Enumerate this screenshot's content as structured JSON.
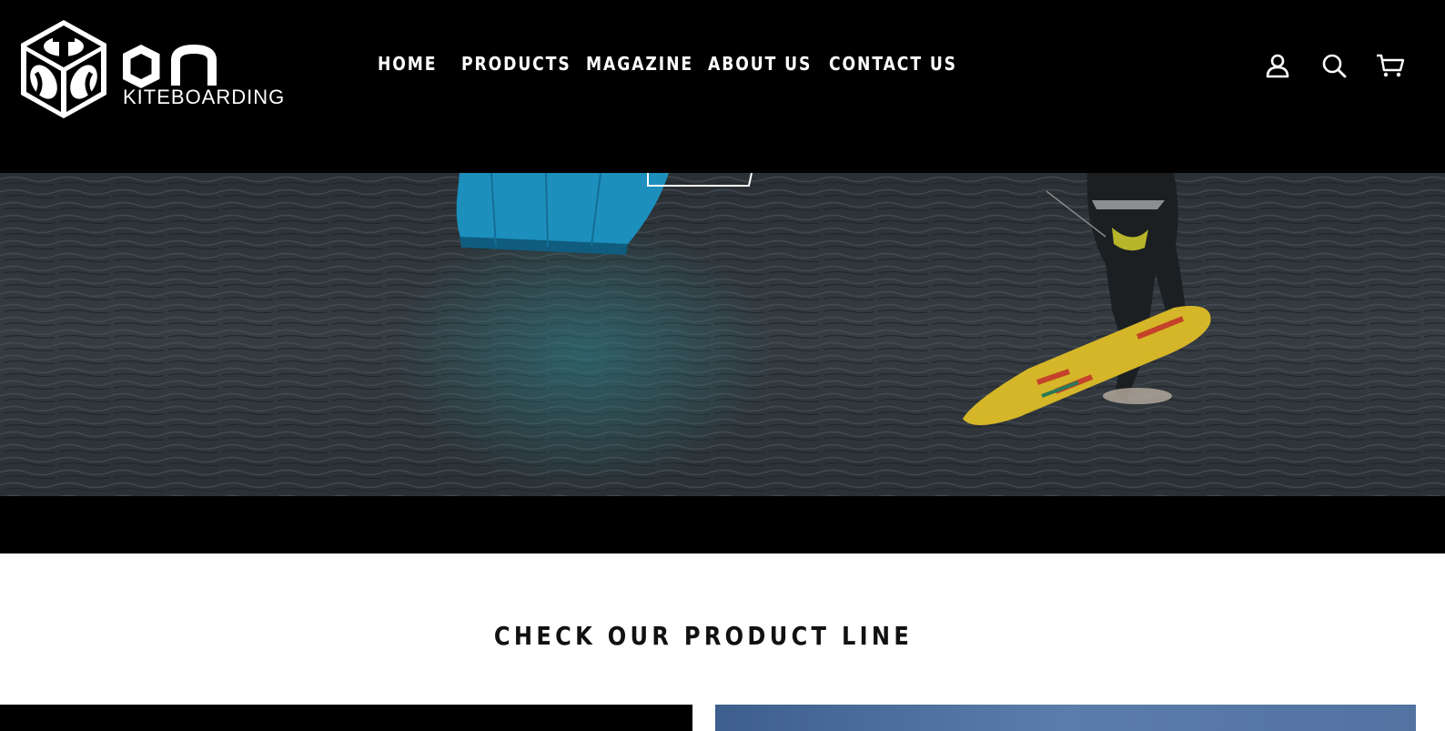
{
  "brand": {
    "logo_text": "on",
    "logo_subtext": "KITEBOARDING"
  },
  "nav": {
    "items": [
      {
        "label": "HOME"
      },
      {
        "label": "PRODUCTS"
      },
      {
        "label": "MAGAZINE"
      },
      {
        "label": "ABOUT US"
      },
      {
        "label": "CONTACT US"
      }
    ]
  },
  "header_icons": {
    "account": "user-icon",
    "search": "search-icon",
    "cart": "cart-icon"
  },
  "hero": {
    "image": "kitesurfer-on-water",
    "button_label": ""
  },
  "product_section": {
    "title": "CHECK OUR PRODUCT LINE"
  },
  "colors": {
    "header_bg": "#000000",
    "text_on_dark": "#ffffff",
    "title_text": "#111111",
    "water": "#2e3438",
    "kite": "#1f8fb8",
    "board": "#d9b92b"
  }
}
